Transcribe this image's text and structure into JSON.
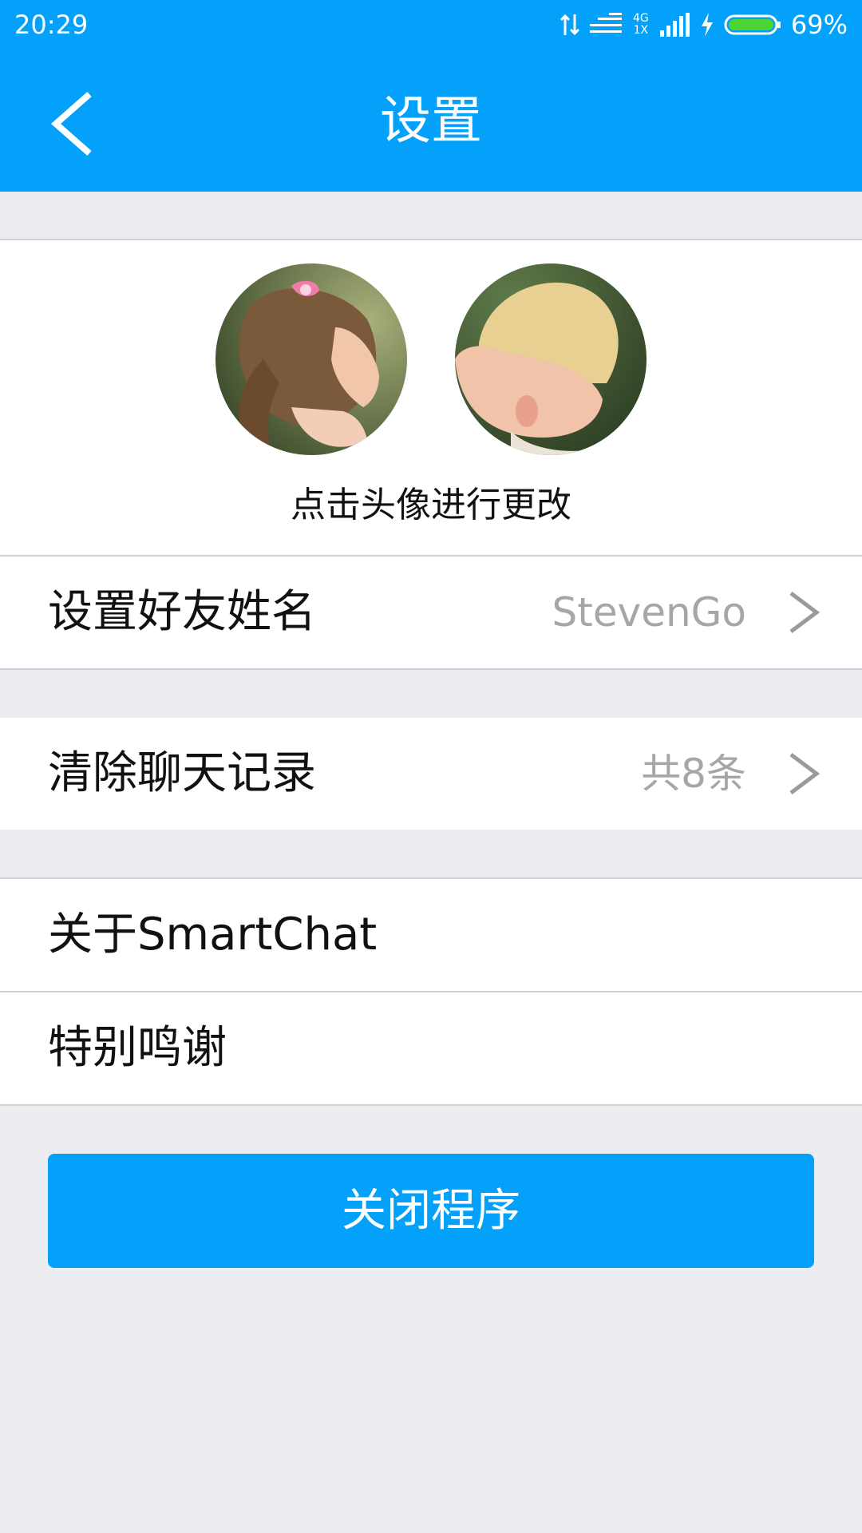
{
  "status_bar": {
    "time": "20:29",
    "network": "4G 1X",
    "battery_percent": "69%",
    "battery_level": 0.69
  },
  "app_bar": {
    "back_icon": "chevron-left-icon",
    "title": "设置"
  },
  "profile": {
    "hint": "点击头像进行更改"
  },
  "rows": {
    "friend_name": {
      "label": "设置好友姓名",
      "value": "StevenGo"
    },
    "clear_history": {
      "label": "清除聊天记录",
      "value": "共8条"
    },
    "about": {
      "label": "关于SmartChat"
    },
    "thanks": {
      "label": "特别鸣谢"
    }
  },
  "close_button": {
    "label": "关闭程序"
  },
  "colors": {
    "accent": "#03a1fa",
    "background": "#ebedf1",
    "secondary_text": "#a6a6a6"
  }
}
